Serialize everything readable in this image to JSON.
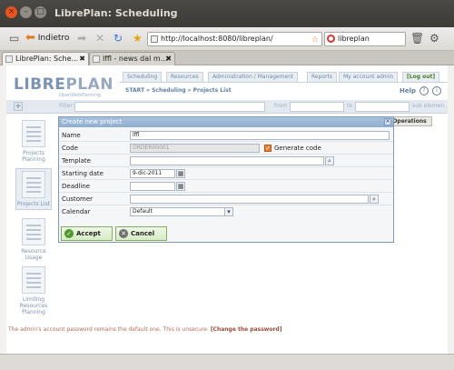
{
  "window": {
    "title": "LibrePlan: Scheduling"
  },
  "browser": {
    "back_label": "Indietro",
    "url": "http://localhost:8080/libreplan/",
    "search_value": "libreplan",
    "tabs": [
      {
        "label": "LibrePlan: Sche...",
        "active": true
      },
      {
        "label": "lffl - news dal m...",
        "active": false
      }
    ]
  },
  "app": {
    "logo_main": "LIBRE",
    "logo_accent": "PLAN",
    "logo_sub": "OpenWebPlanning",
    "menu": [
      "Scheduling",
      "Resources",
      "Administration / Management",
      "Reports",
      "My account admin",
      "[Log out]"
    ],
    "breadcrumb": "START  »  Scheduling  »  Projects List",
    "help_label": "Help",
    "filter": {
      "label": "Filter:",
      "from_label": "from",
      "to_label": "to",
      "sub_label": "sub elemen"
    },
    "operations_label": "Operations",
    "sidebar": [
      {
        "label": "Projects Planning",
        "active": false
      },
      {
        "label": "Projects List",
        "active": true
      },
      {
        "label": "Resource Usage",
        "active": false
      },
      {
        "label": "Limiting Resources Planning",
        "active": false
      }
    ],
    "warning_text": "The admin's account password remains the default one. This is unsecure.",
    "warning_link": "[Change the password]"
  },
  "dialog": {
    "title": "Create new project",
    "name_label": "Name",
    "name_value": "lffl",
    "code_label": "Code",
    "code_value": "ORDER00001",
    "generate_code_label": "Generate code",
    "generate_code_checked": true,
    "template_label": "Template",
    "template_value": "",
    "start_label": "Starting date",
    "start_value": "9-dic-2011",
    "deadline_label": "Deadline",
    "deadline_value": "",
    "customer_label": "Customer",
    "customer_value": "",
    "calendar_label": "Calendar",
    "calendar_value": "Default",
    "accept_label": "Accept",
    "cancel_label": "Cancel"
  }
}
